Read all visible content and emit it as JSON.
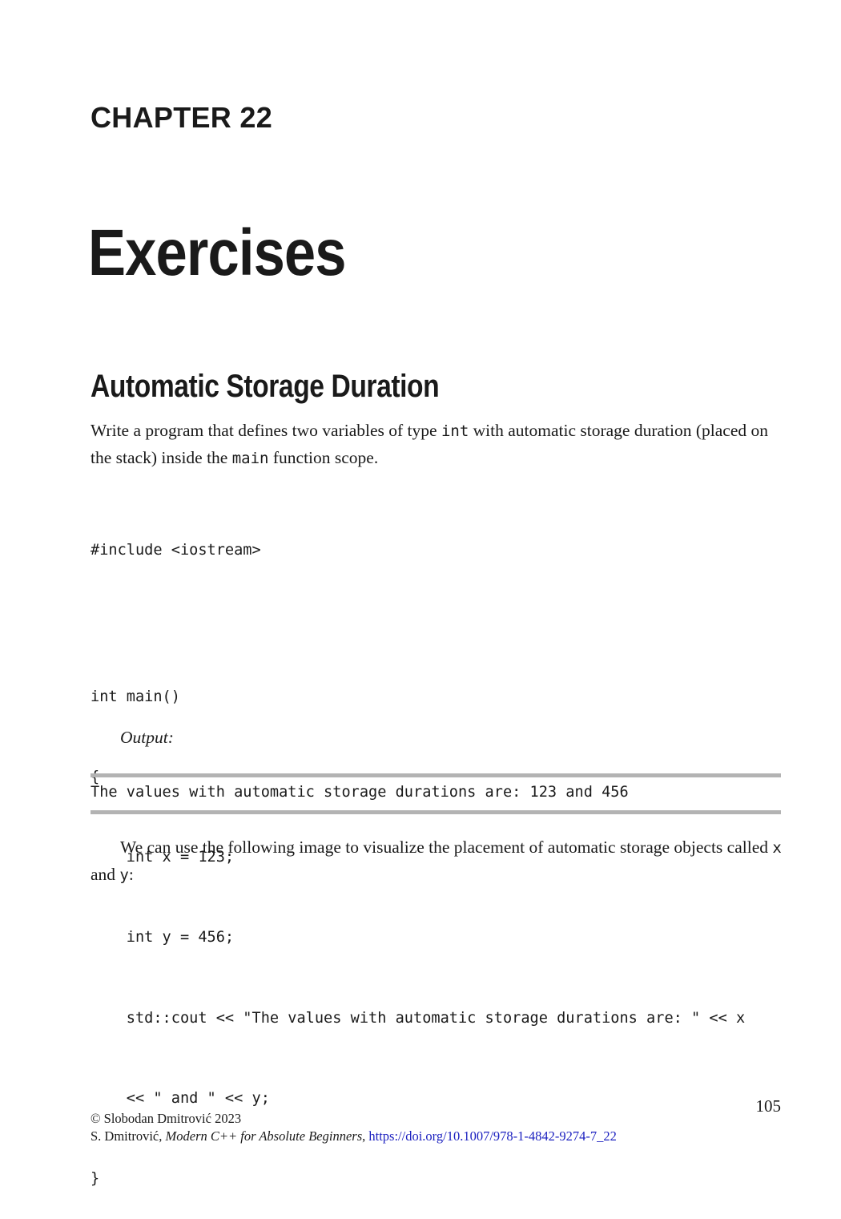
{
  "chapter": {
    "label": "CHAPTER 22",
    "title": "Exercises"
  },
  "section": {
    "heading": "Automatic Storage Duration",
    "intro": {
      "part1": "Write a program that defines two variables of type ",
      "code1": "int",
      "part2": " with automatic storage duration (placed on the stack) inside the ",
      "code2": "main",
      "part3": " function scope."
    }
  },
  "code": {
    "include_line": "#include <iostream>",
    "lines": [
      "int main()",
      "{",
      "    int x = 123;",
      "    int y = 456;",
      "    std::cout << \"The values with automatic storage durations are: \" << x",
      "    << \" and \" << y;",
      "}"
    ]
  },
  "output": {
    "label": "Output:",
    "text": "The values with automatic storage durations are: 123 and 456"
  },
  "followup": {
    "part1": "We can use the following image to visualize the placement of automatic storage objects called ",
    "code1": "x",
    "part2": " and ",
    "code2": "y",
    "part3": ":"
  },
  "footer": {
    "page_number": "105",
    "copyright": "© Slobodan Dmitrović 2023",
    "citation_author": "S. Dmitrović, ",
    "citation_title": "Modern C++ for Absolute Beginners",
    "citation_sep": ", ",
    "doi": "https://doi.org/10.1007/978-1-4842-9274-7_22"
  },
  "colors": {
    "text": "#1a1a1a",
    "link": "#1a1fbf",
    "rule": "#b3b3b3"
  }
}
